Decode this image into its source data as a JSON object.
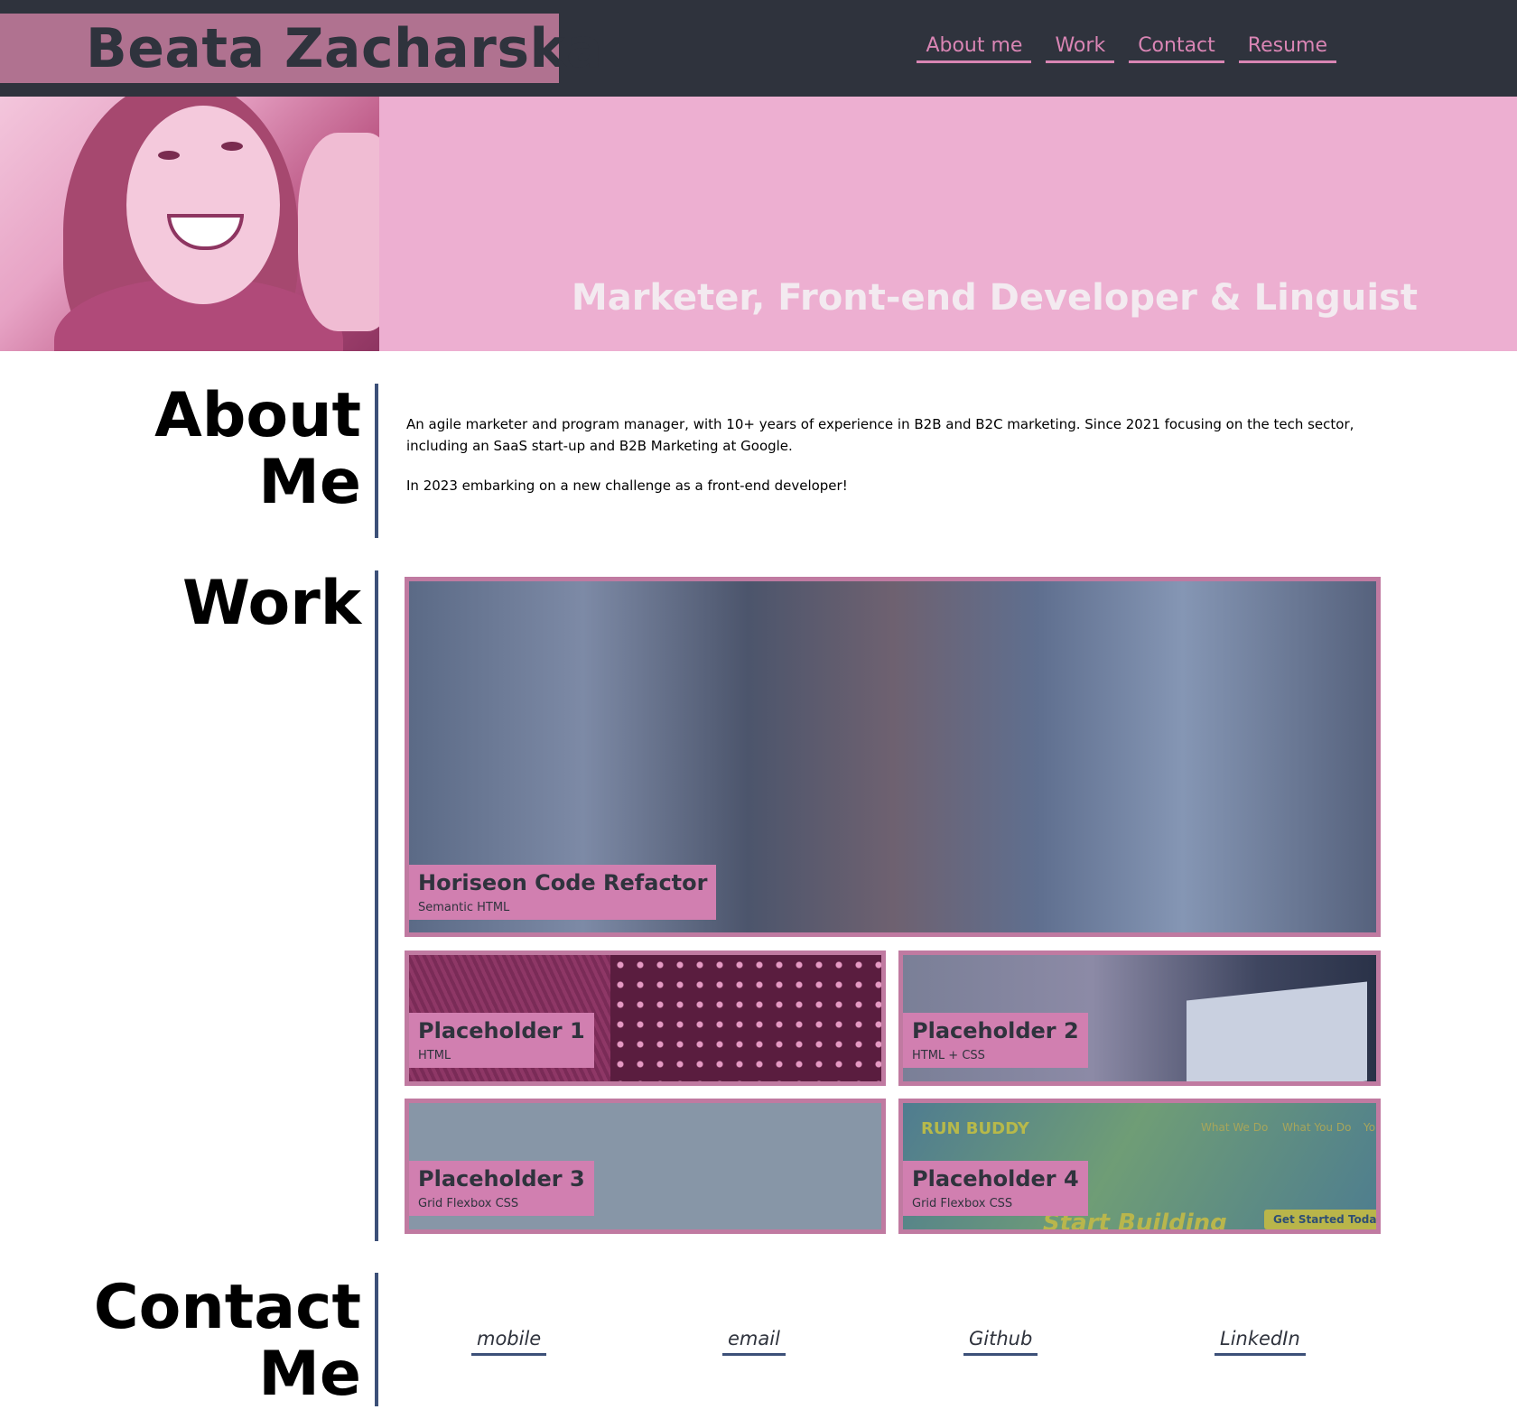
{
  "header": {
    "brand": "Beata Zacharska",
    "nav": [
      "About me",
      "Work",
      "Contact",
      "Resume"
    ]
  },
  "hero": {
    "tagline": "Marketer, Front-end Developer & Linguist"
  },
  "about": {
    "title_line1": "About",
    "title_line2": "Me",
    "paragraphs": [
      "An agile marketer and program manager, with 10+ years of experience in B2B and B2C marketing. Since 2021 focusing on the tech sector, including an SaaS start-up and B2B Marketing at Google.",
      "In 2023 embarking on a new challenge as a front-end developer!"
    ]
  },
  "work": {
    "title": "Work",
    "projects": [
      {
        "title": "Horiseon Code Refactor",
        "subtitle": "Semantic HTML"
      },
      {
        "title": "Placeholder 1",
        "subtitle": "HTML"
      },
      {
        "title": "Placeholder 2",
        "subtitle": "HTML + CSS"
      },
      {
        "title": "Placeholder 3",
        "subtitle": "Grid Flexbox CSS"
      },
      {
        "title": "Placeholder 4",
        "subtitle": "Grid Flexbox CSS"
      }
    ],
    "runbuddy": {
      "logo": "RUN BUDDY",
      "nav": [
        "What We Do",
        "What You Do",
        "Yo"
      ],
      "hero": "Start Building",
      "cta": "Get Started Today"
    }
  },
  "contact": {
    "title_line1": "Contact",
    "title_line2": "Me",
    "links": [
      "mobile",
      "email",
      "Github",
      "LinkedIn"
    ]
  },
  "colors": {
    "header_bg": "#2f333d",
    "brand_bg": "#b07290",
    "accent_pink": "#d985b4",
    "hero_bg": "#edafd1",
    "section_line": "#3c5078"
  }
}
